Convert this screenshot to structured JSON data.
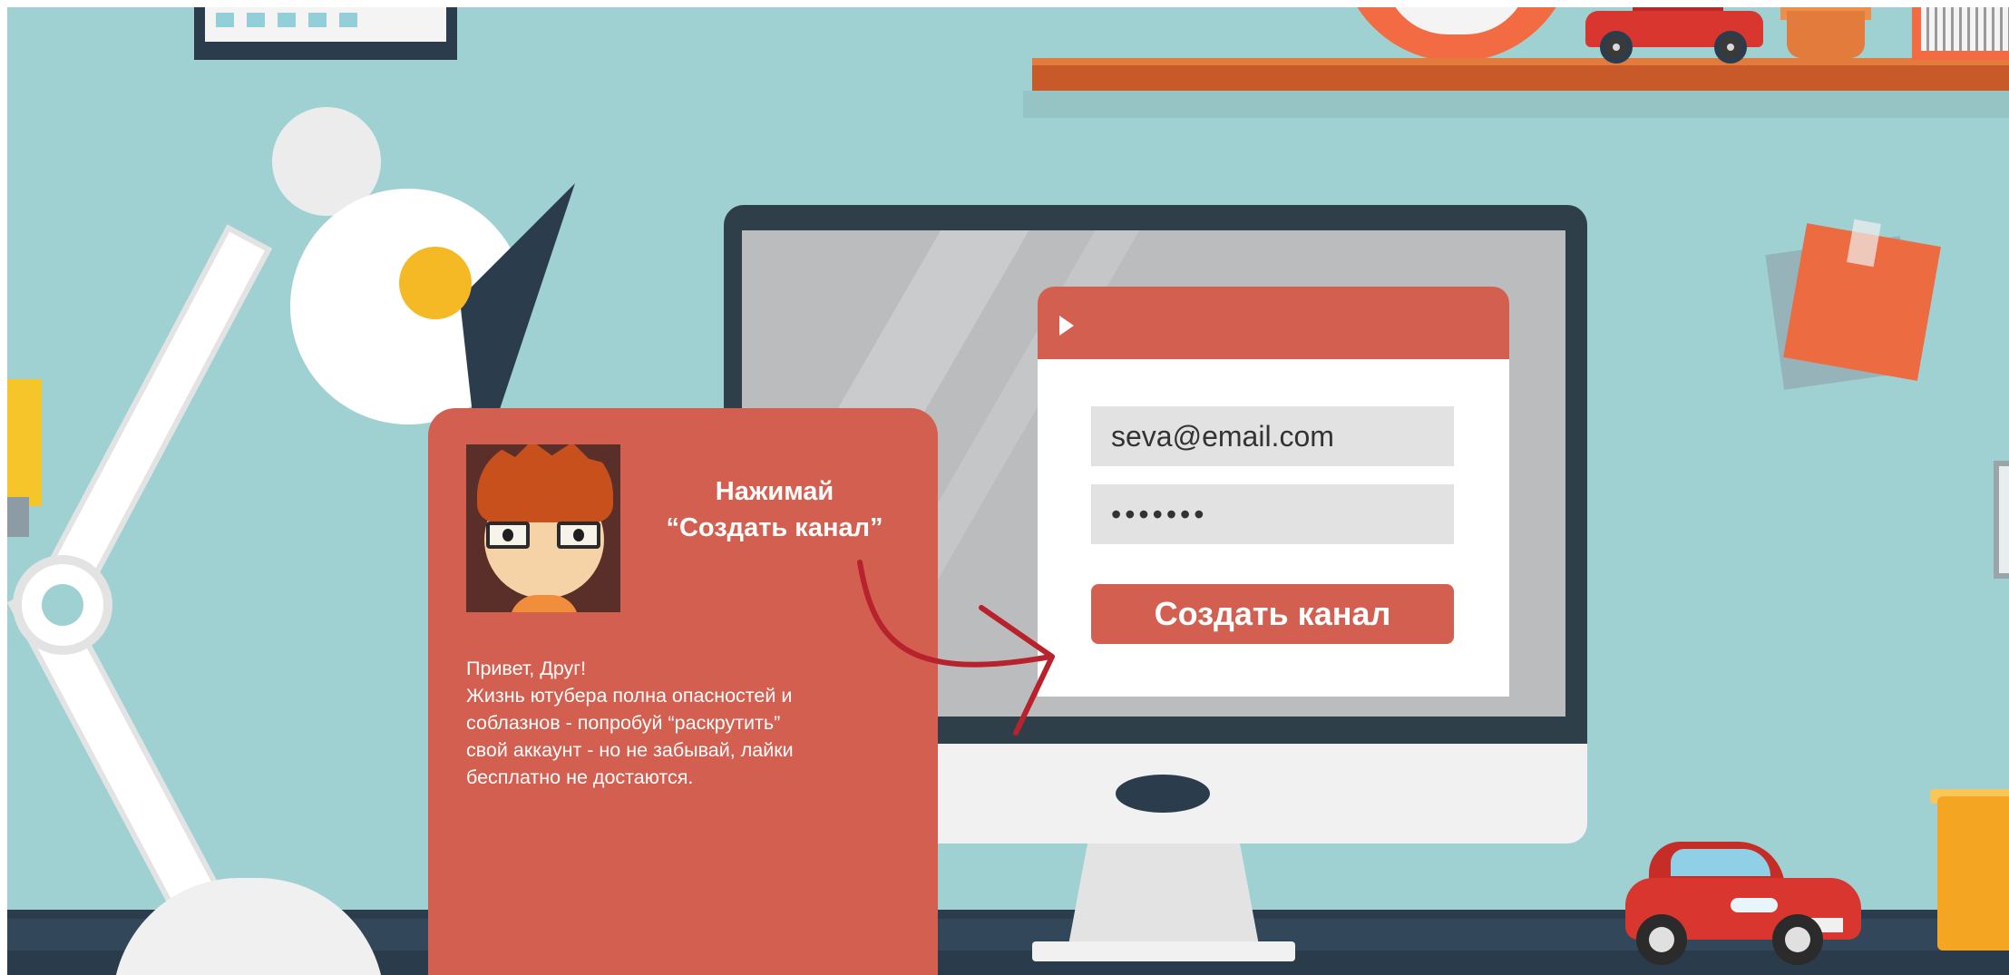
{
  "login": {
    "email_value": "seva@email.com",
    "password_value": "•••••••",
    "create_button": "Создать канал"
  },
  "speech": {
    "title_line1": "Нажимай",
    "title_line2": "“Создать канал”",
    "body_lines": [
      "Привет, Друг!",
      "Жизнь ютубера полна опасностей и",
      "соблазнов - попробуй “раскрутить”",
      "свой аккаунт - но не забывай, лайки",
      "бесплатно не достаются."
    ]
  },
  "icons": {
    "play": "play-icon",
    "arrow": "curved-arrow-icon",
    "avatar": "avatar-illustration"
  },
  "colors": {
    "background": "#a0d1d2",
    "accent_red": "#d35f51",
    "field_gray": "#e2e2e2",
    "desk": "#2b3d4d",
    "arrow_red": "#b8222d"
  }
}
